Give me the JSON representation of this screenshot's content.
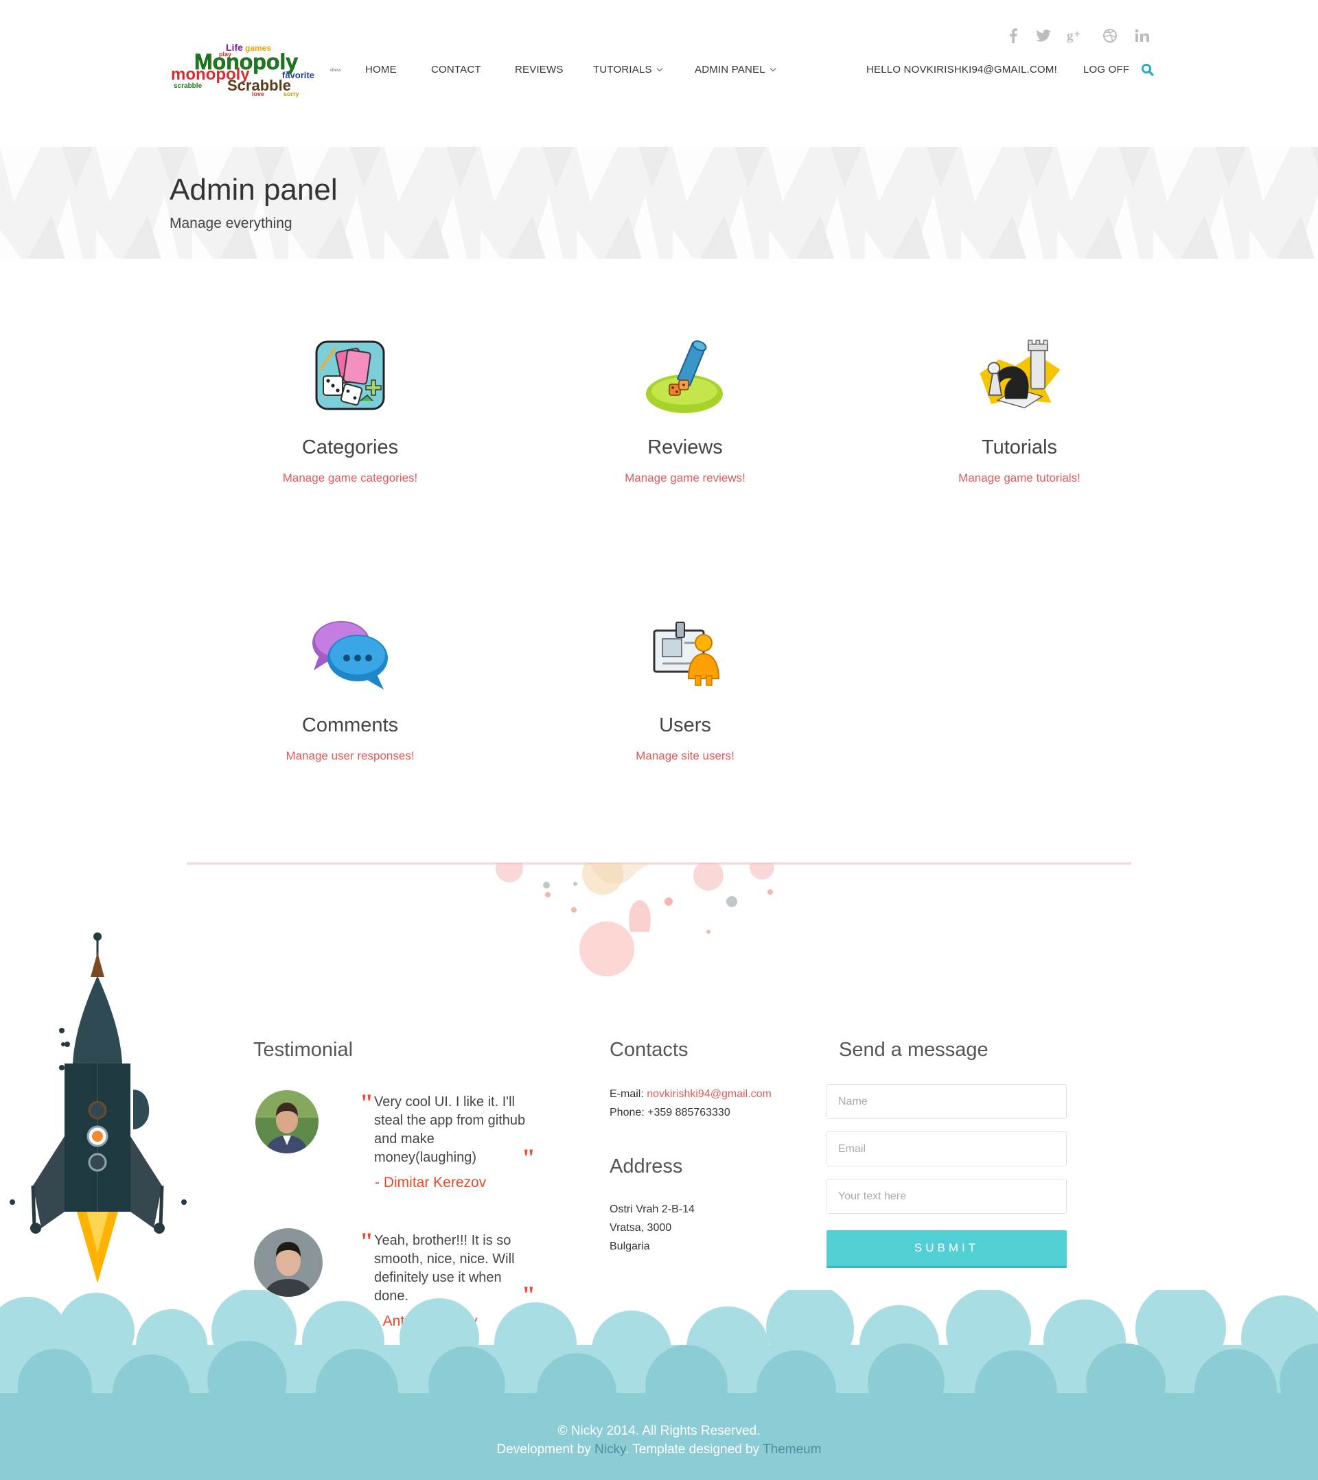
{
  "header": {
    "logo_words": [
      "Life",
      "Monopoly",
      "monopoly",
      "Scrabble",
      "play",
      "games",
      "favorite",
      "love",
      "sorry",
      "scrabble",
      "chess"
    ],
    "nav": {
      "home": "HOME",
      "contact": "CONTACT",
      "reviews": "REVIEWS",
      "tutorials": "TUTORIALS",
      "admin": "ADMIN PANEL",
      "greeting": "HELLO NOVKIRISHKI94@GMAIL.COM!",
      "logoff": "LOG OFF"
    },
    "social_icons": [
      "facebook-icon",
      "twitter-icon",
      "google-plus-icon",
      "dribbble-icon",
      "linkedin-icon"
    ]
  },
  "page": {
    "title": "Admin panel",
    "subtitle": "Manage everything"
  },
  "tiles": [
    {
      "title": "Categories",
      "desc": "Manage game categories!",
      "icon": "cards-dice-icon"
    },
    {
      "title": "Reviews",
      "desc": "Manage game reviews!",
      "icon": "dice-cup-icon"
    },
    {
      "title": "Tutorials",
      "desc": "Manage game tutorials!",
      "icon": "chess-icon"
    },
    {
      "title": "Comments",
      "desc": "Manage user responses!",
      "icon": "chat-bubbles-icon"
    },
    {
      "title": "Users",
      "desc": "Manage site users!",
      "icon": "user-card-icon"
    }
  ],
  "footer": {
    "testimonial": {
      "title": "Testimonial",
      "open_quote": "\"",
      "close_quote": "\"",
      "items": [
        {
          "text": "Very cool UI. I like it. I'll steal the app from github and make money(laughing)",
          "author": "- Dimitar Kerezov"
        },
        {
          "text": "Yeah, brother!!! It is so smooth, nice, nice. Will definitely use it when done.",
          "author": "- Antonio Filipov"
        }
      ]
    },
    "contacts": {
      "title": "Contacts",
      "email_label": "E-mail: ",
      "email": "novkirishki94@gmail.com",
      "phone": "Phone: +359 885763330"
    },
    "address": {
      "title": "Address",
      "line1": "Ostri Vrah 2-B-14",
      "line2": "Vratsa, 3000",
      "line3": "Bulgaria"
    },
    "message": {
      "title": "Send a message",
      "name_placeholder": "Name",
      "email_placeholder": "Email",
      "text_placeholder": "Your text here",
      "submit": "SUBMIT"
    },
    "copyright": {
      "line1": "© Nicky 2014. All Rights Reserved.",
      "dev_prefix": "Development by ",
      "dev_name": "Nicky",
      "template_prefix": ". Template designed by ",
      "template_name": "Themeum"
    }
  },
  "colors": {
    "accent": "#52cfd4",
    "link_red": "#e05a5a",
    "quote_red": "#e8492b",
    "cloud_light": "#a8dde4",
    "cloud_dark": "#8ccdd5"
  }
}
